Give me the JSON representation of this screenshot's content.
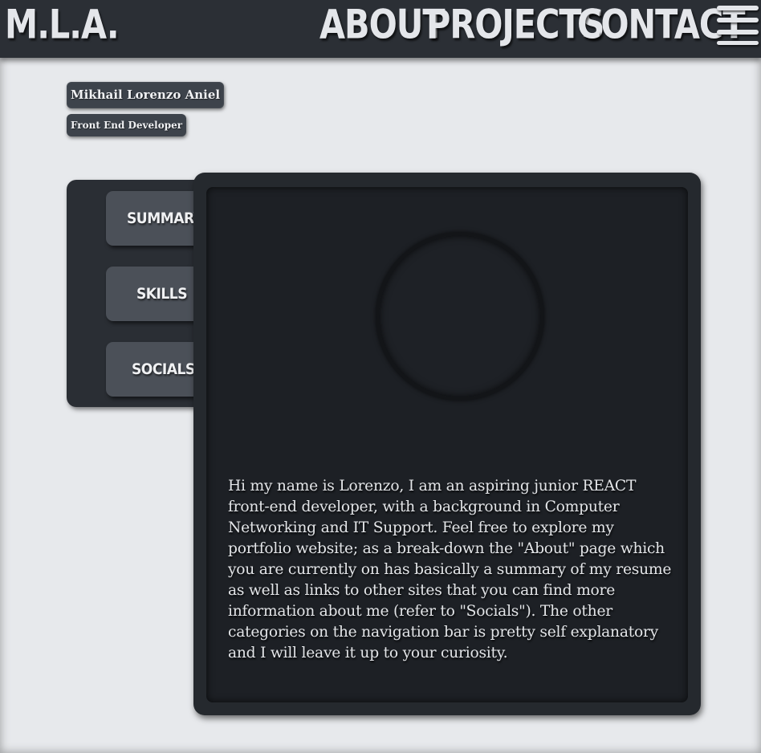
{
  "header": {
    "brand": "M.L.A.",
    "nav": [
      "ABOUT",
      "PROJECTS",
      "CONTACT"
    ],
    "menu_icon": "hamburger-icon"
  },
  "profile": {
    "name": "Mikhail Lorenzo Aniel",
    "role": "Front End Developer"
  },
  "tabs": [
    "SUMMARY",
    "SKILLS",
    "SOCIALS"
  ],
  "content": {
    "bio": "Hi my name is Lorenzo, I am an aspiring junior REACT front-end developer, with a background in Computer Networking and IT Support. Feel free to explore my portfolio website; as a break-down the \"About\" page which you are currently on has basically a summary of my resume as well as links to other sites that you can find more information about me (refer to \"Socials\"). The other categories on the navigation bar is pretty self explanatory and I will leave it up to your curiosity."
  },
  "colors": {
    "navbar": "#2b2f35",
    "background": "#e7e9ec",
    "card": "#25292e",
    "tab": "#4b5058",
    "text_light": "#e4e6ea"
  }
}
